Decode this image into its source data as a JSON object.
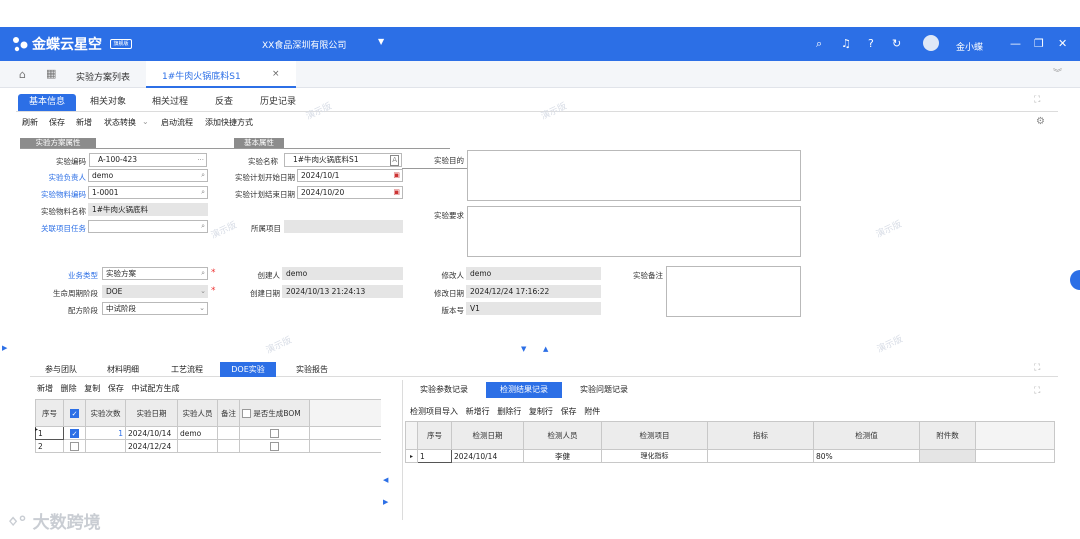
{
  "app": {
    "logo": "金蝶云星空",
    "badge": "旗舰版",
    "company": "XX食品深圳有限公司",
    "user": "金小蝶"
  },
  "tabs": {
    "list": "实验方案列表",
    "active": "1#牛肉火锅底料S1",
    "close": "×"
  },
  "subtabs": [
    "基本信息",
    "相关对象",
    "相关过程",
    "反查",
    "历史记录"
  ],
  "toolbar": [
    "刷新",
    "保存",
    "新增",
    "状态转换",
    "启动流程",
    "添加快捷方式"
  ],
  "sections": {
    "s1": "实验方案属性",
    "s2": "基本属性"
  },
  "form": {
    "code_label": "实验编码",
    "code": "A-100-423",
    "owner_label": "实验负责人",
    "owner": "demo",
    "mat_code_label": "实验物料编码",
    "mat_code": "1-0001",
    "mat_name_label": "实验物料名称",
    "mat_name": "1#牛肉火锅底料",
    "task_label": "关联项目任务",
    "name_label": "实验名称",
    "name": "1#牛肉火锅底料S1",
    "start_label": "实验计划开始日期",
    "start": "2024/10/1",
    "end_label": "实验计划结束日期",
    "end": "2024/10/20",
    "project_label": "所属项目",
    "purpose_label": "实验目的",
    "req_label": "实验要求",
    "biz_label": "业务类型",
    "biz": "实验方案",
    "life_label": "生命周期阶段",
    "life": "DOE",
    "phase_label": "配方阶段",
    "phase": "中试阶段",
    "creator_label": "创建人",
    "creator": "demo",
    "cdate_label": "创建日期",
    "cdate": "2024/10/13 21:24:13",
    "modifier_label": "修改人",
    "modifier": "demo",
    "mdate_label": "修改日期",
    "mdate": "2024/12/24 17:16:22",
    "ver_label": "版本号",
    "ver": "V1",
    "note_label": "实验备注"
  },
  "lower_tabs": [
    "参与团队",
    "材料明细",
    "工艺流程",
    "DOE实验",
    "实验报告"
  ],
  "left_toolbar": [
    "新增",
    "删除",
    "复制",
    "保存",
    "中试配方生成"
  ],
  "left_table": {
    "headers": [
      "序号",
      "",
      "实验次数",
      "实验日期",
      "实验人员",
      "备注",
      "是否生成BOM"
    ],
    "rows": [
      {
        "no": "1",
        "count": "1",
        "date": "2024/10/14",
        "person": "demo"
      },
      {
        "no": "2",
        "count": "",
        "date": "2024/12/24",
        "person": ""
      }
    ]
  },
  "right_tabs": [
    "实验参数记录",
    "检测结果记录",
    "实验问题记录"
  ],
  "right_toolbar": [
    "检测项目导入",
    "新增行",
    "删除行",
    "复制行",
    "保存",
    "附件"
  ],
  "right_table": {
    "headers": [
      "序号",
      "检测日期",
      "检测人员",
      "检测项目",
      "指标",
      "检测值",
      "附件数"
    ],
    "rows": [
      {
        "no": "1",
        "date": "2024/10/14",
        "person": "李健",
        "item": "理化指标",
        "index": "",
        "value": "80%",
        "att": ""
      }
    ]
  },
  "watermark": "演示版",
  "brand": "大数跨境"
}
